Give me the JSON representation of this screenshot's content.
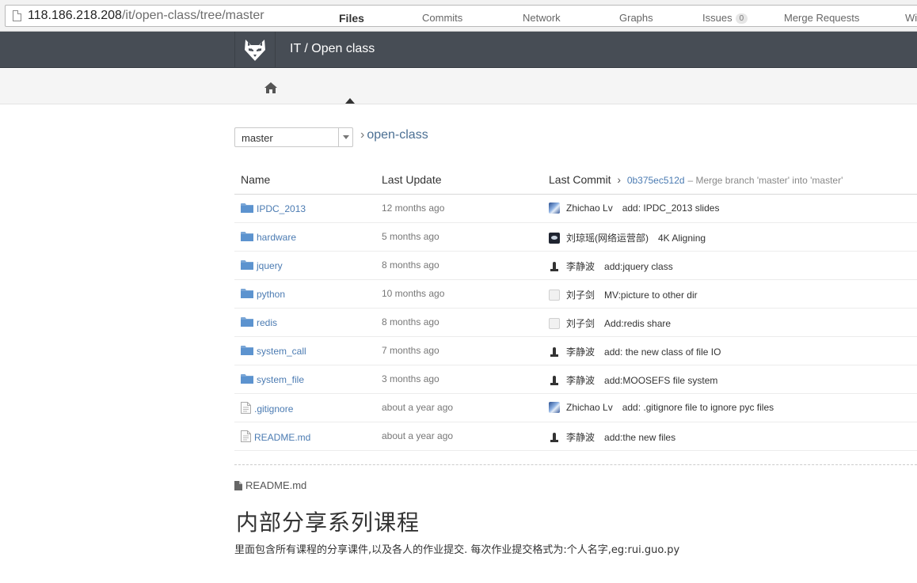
{
  "browser": {
    "url_host": "118.186.218.208",
    "url_path": "/it/open-class/tree/master"
  },
  "header": {
    "project_title": "IT / Open class",
    "logo_icon": "gitlab-fox-logo-icon"
  },
  "tabs": {
    "home_icon": "home-icon",
    "items": [
      {
        "label": "Files",
        "active": true
      },
      {
        "label": "Commits"
      },
      {
        "label": "Network"
      },
      {
        "label": "Graphs"
      },
      {
        "label": "Issues",
        "badge": "0"
      },
      {
        "label": "Merge Requests"
      },
      {
        "label": "Wi"
      }
    ]
  },
  "branch": {
    "selected": "master",
    "breadcrumb_sep": "›",
    "breadcrumb": "open-class"
  },
  "table": {
    "headers": {
      "name": "Name",
      "last_update": "Last Update",
      "last_commit": "Last Commit",
      "commit_sep": "›",
      "commit_hash": "0b375ec512d",
      "commit_message": "– Merge branch 'master' into 'master'"
    },
    "rows": [
      {
        "type": "folder",
        "name": "IPDC_2013",
        "updated": "12 months ago",
        "avatar": "blue",
        "author": "Zhichao Lv",
        "message": "add: IPDC_2013 slides"
      },
      {
        "type": "folder",
        "name": "hardware",
        "updated": "5 months ago",
        "avatar": "dark",
        "author": "刘琼瑶(网络运营部)",
        "message": "4K Aligning"
      },
      {
        "type": "folder",
        "name": "jquery",
        "updated": "8 months ago",
        "avatar": "figure",
        "author": "李静波",
        "message": "add:jquery class"
      },
      {
        "type": "folder",
        "name": "python",
        "updated": "10 months ago",
        "avatar": "blank",
        "author": "刘子剑",
        "message": "MV:picture to other dir"
      },
      {
        "type": "folder",
        "name": "redis",
        "updated": "8 months ago",
        "avatar": "blank",
        "author": "刘子剑",
        "message": "Add:redis share"
      },
      {
        "type": "folder",
        "name": "system_call",
        "updated": "7 months ago",
        "avatar": "figure",
        "author": "李静波",
        "message": "add: the new class of file IO"
      },
      {
        "type": "folder",
        "name": "system_file",
        "updated": "3 months ago",
        "avatar": "figure",
        "author": "李静波",
        "message": "add:MOOSEFS file system"
      },
      {
        "type": "file",
        "name": ".gitignore",
        "updated": "about a year ago",
        "avatar": "blue",
        "author": "Zhichao Lv",
        "message": "add: .gitignore file to ignore pyc files"
      },
      {
        "type": "file",
        "name": "README.md",
        "updated": "about a year ago",
        "avatar": "figure",
        "author": "李静波",
        "message": "add:the new files"
      }
    ]
  },
  "readme": {
    "label": "README.md",
    "title": "内部分享系列课程",
    "text": "里面包含所有课程的分享课件,以及各人的作业提交. 每次作业提交格式为:个人名字,eg:rui.guo.py"
  },
  "colors": {
    "header_bg": "#474d55",
    "link": "#4b7bb2",
    "tab_bg": "#f5f5f5"
  }
}
